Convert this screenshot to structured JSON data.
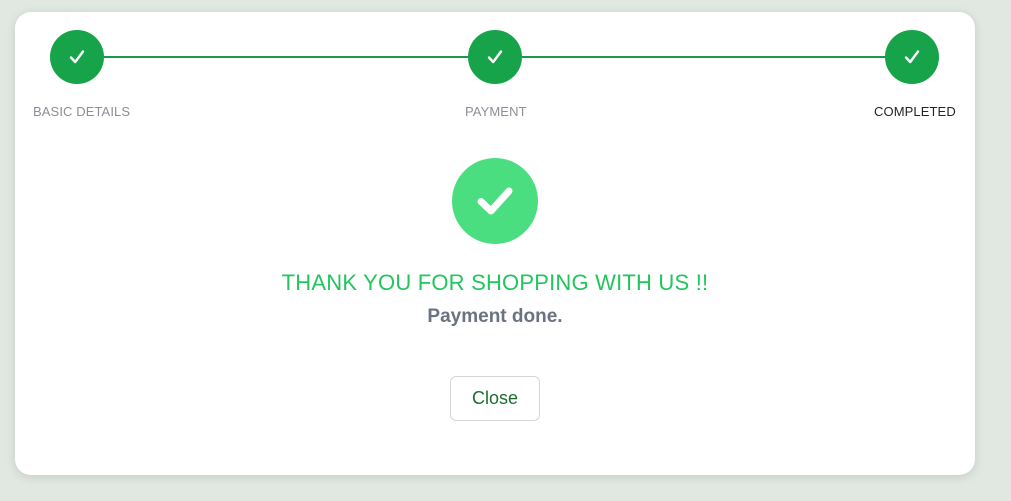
{
  "stepper": {
    "steps": [
      {
        "label": "BASIC DETAILS",
        "status": "done",
        "icon": "checkmark-icon"
      },
      {
        "label": "PAYMENT",
        "status": "done",
        "icon": "checkmark-icon"
      },
      {
        "label": "COMPLETED",
        "status": "active",
        "icon": "checkmark-icon"
      }
    ]
  },
  "result": {
    "icon": "check-circle-icon",
    "title": "THANK YOU FOR SHOPPING WITH US !!",
    "message": "Payment done."
  },
  "actions": {
    "close_label": "Close"
  },
  "colors": {
    "step_green": "#17a34a",
    "success_green": "#4ade80",
    "title_green": "#22c55e",
    "page_bg": "#e1e7e1"
  }
}
